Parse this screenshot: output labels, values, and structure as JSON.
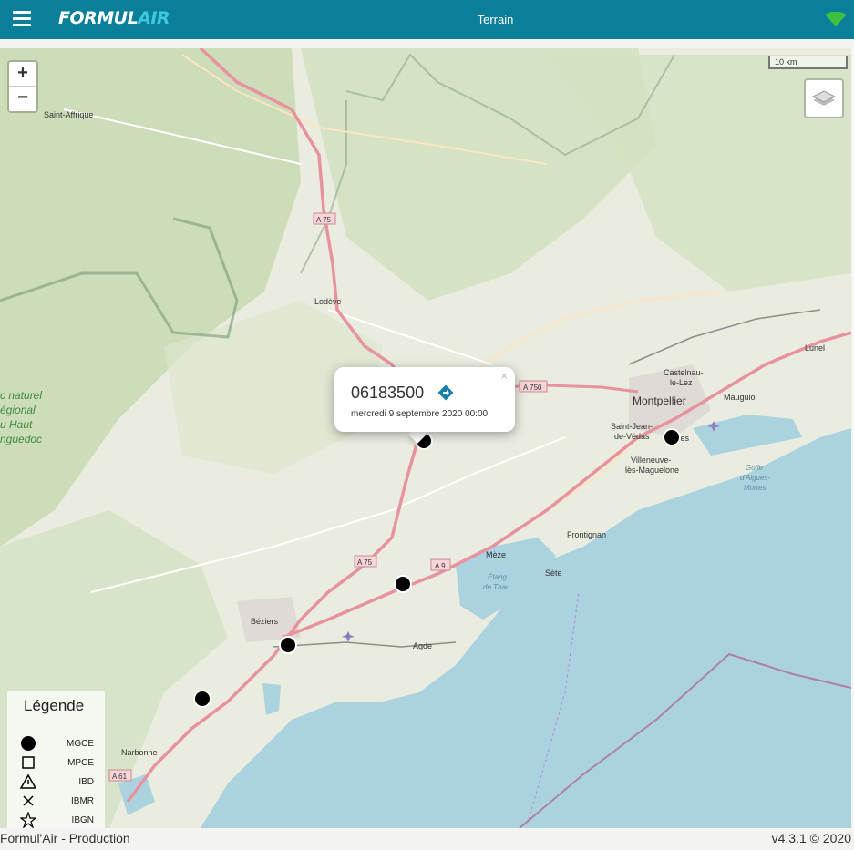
{
  "header": {
    "logo_part1": "FORMUL",
    "logo_part2": "AIR",
    "title": "Terrain",
    "bg_color": "#0a7f9a"
  },
  "map": {
    "scale_label": "10 km",
    "zoom_in": "+",
    "zoom_out": "−",
    "places": {
      "saint_affrique": "Saint-Affrique",
      "lodeve": "Lodève",
      "montpellier": "Montpellier",
      "castelnau1": "Castelnau-",
      "castelnau2": "le-Lez",
      "mauguio": "Mauguio",
      "lunel": "Lunel",
      "sjv1": "Saint-Jean-",
      "sjv2": "de-Védas",
      "ville1": "Villeneuve-",
      "ville2": "lès-Maguelone",
      "frontignan": "Frontignan",
      "meze": "Mèze",
      "sete": "Sète",
      "beziers": "Béziers",
      "agde": "Agde",
      "narbonne": "Narbonne",
      "etang1": "Étang",
      "etang2": "de Thau",
      "golfe1": "Golfe",
      "golfe2": "d'Aigues-",
      "golfe3": "Mortes",
      "lattes_frag": "tes",
      "park1": "c naturel",
      "park2": "égional",
      "park3": "u Haut",
      "park4": "nguedoc"
    },
    "roads": {
      "a75_north": "A 75",
      "a750": "A 750",
      "a75_south": "A 75",
      "a9": "A 9",
      "a61": "A 61"
    }
  },
  "popup": {
    "station_id": "06183500",
    "date": "mercredi 9 septembre 2020 00:00",
    "close": "×"
  },
  "legend": {
    "title": "Légende",
    "items": [
      {
        "label": "MGCE",
        "icon": "filled-circle-icon"
      },
      {
        "label": "MPCE",
        "icon": "square-outline-icon"
      },
      {
        "label": "IBD",
        "icon": "warning-triangle-icon"
      },
      {
        "label": "IBMR",
        "icon": "cross-icon"
      },
      {
        "label": "IBGN",
        "icon": "star-outline-icon"
      }
    ]
  },
  "footer": {
    "left": "Formul'Air - Production",
    "right": "v4.3.1 © 2020"
  }
}
